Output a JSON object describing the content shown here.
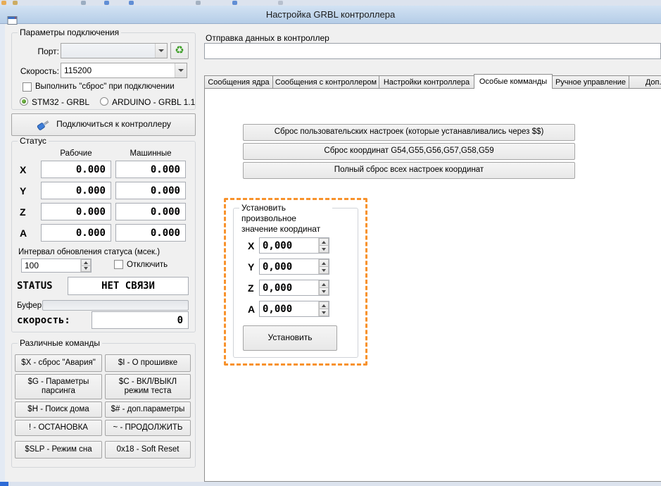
{
  "window": {
    "title": "Настройка GRBL контроллера"
  },
  "connection": {
    "title": "Параметры подключения",
    "port_label": "Порт:",
    "port_value": "",
    "speed_label": "Скорость:",
    "speed_value": "115200",
    "reset_checkbox_label": "Выполнить \"сброс\" при подключении",
    "radio_stm32_label": "STM32 - GRBL",
    "radio_arduino_label": "ARDUINO - GRBL 1.1",
    "connect_button_label": "Подключиться к контроллеру"
  },
  "status": {
    "title": "Статус",
    "col_work": "Рабочие",
    "col_machine": "Машинные",
    "axes": [
      {
        "name": "X",
        "work": "0.000",
        "machine": "0.000"
      },
      {
        "name": "Y",
        "work": "0.000",
        "machine": "0.000"
      },
      {
        "name": "Z",
        "work": "0.000",
        "machine": "0.000"
      },
      {
        "name": "A",
        "work": "0.000",
        "machine": "0.000"
      }
    ],
    "interval_label": "Интервал обновления статуса (мсек.)",
    "interval_value": "100",
    "disable_checkbox_label": "Отключить",
    "status_label": "STATUS",
    "status_value": "НЕТ СВЯЗИ",
    "buffer_label": "Буфер",
    "speed_label": "скорость:",
    "speed_value": "0"
  },
  "commands": {
    "title": "Различные команды",
    "buttons": [
      "$X - сброс \"Авария\"",
      "$I - О прошивке",
      "$G - Параметры парсинга",
      "$C - ВКЛ/ВЫКЛ режим теста",
      "$H - Поиск дома",
      "$# - доп.параметры",
      "! - ОСТАНОВКА",
      "~ - ПРОДОЛЖИТЬ",
      "$SLP - Режим сна",
      "0x18 - Soft Reset"
    ]
  },
  "send": {
    "label": "Отправка данных в контроллер",
    "value": ""
  },
  "tabs": {
    "active_index": 3,
    "items": [
      {
        "label": "Сообщения ядра"
      },
      {
        "label": "Сообщения с контроллером"
      },
      {
        "label": "Настройки контроллера"
      },
      {
        "label": "Особые комманды"
      },
      {
        "label": "Ручное управление"
      },
      {
        "label": "Доп. ста"
      }
    ]
  },
  "special_tab": {
    "reset_user_label": "Сброс пользовательских настроек (которые устанавливались через $$)",
    "reset_coords_label": "Сброс координат G54,G55,G56,G57,G58,G59",
    "full_reset_label": "Полный сброс всех настроек координат",
    "set_group_title": "Установить произвольное значение координат",
    "coords": [
      {
        "name": "X",
        "value": "0,000"
      },
      {
        "name": "Y",
        "value": "0,000"
      },
      {
        "name": "Z",
        "value": "0,000"
      },
      {
        "name": "A",
        "value": "0,000"
      }
    ],
    "set_button_label": "Установить"
  },
  "colors": {
    "highlight_orange": "#f8922c",
    "titlebar_blue": "#b5cde7",
    "refresh_green": "#3a9d23"
  }
}
